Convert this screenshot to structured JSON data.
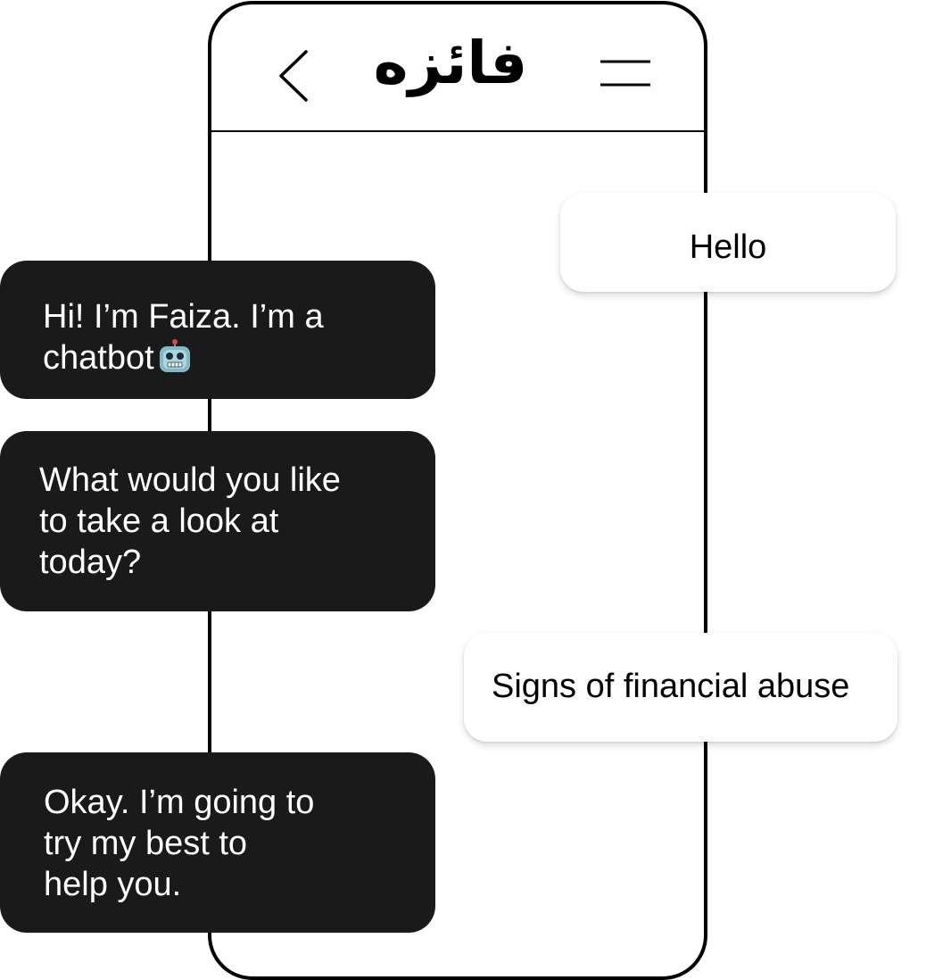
{
  "header": {
    "title": "فائزه",
    "back_icon": "chevron-left-icon",
    "menu_icon": "menu-icon"
  },
  "messages": [
    {
      "sender": "user",
      "lines": [
        "Hello"
      ]
    },
    {
      "sender": "bot",
      "lines": [
        "Hi! I’m Faiza. I’m a",
        "chatbot"
      ],
      "emoji": "robot-face-icon"
    },
    {
      "sender": "bot",
      "lines": [
        "What would you like",
        "to take a look at",
        "today?"
      ]
    },
    {
      "sender": "user",
      "lines": [
        "Signs of financial abuse"
      ]
    },
    {
      "sender": "bot",
      "lines": [
        "Okay. I’m going to",
        "try my best to",
        "help you."
      ]
    }
  ],
  "colors": {
    "bot_bubble": "#1a1a1a",
    "bot_text": "#ffffff",
    "user_bubble": "#ffffff",
    "user_text": "#000000",
    "frame": "#000000"
  }
}
